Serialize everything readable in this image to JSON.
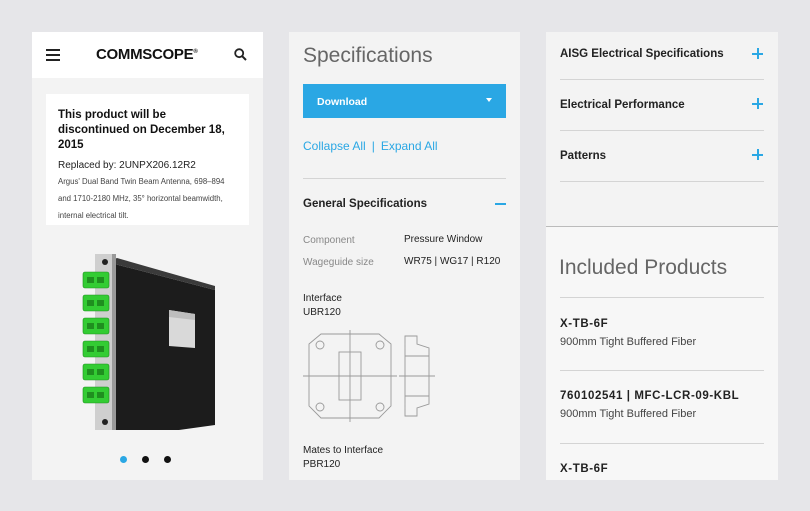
{
  "panel1": {
    "brand": "COMMSCOPE",
    "brand_mark": "®",
    "notice": {
      "title": "This product will be discontinued on December 18, 2015",
      "replaced_by": "Replaced by: 2UNPX206.12R2",
      "description": "Argus' Dual Band Twin Beam Antenna, 698–894 and 1710-2180 MHz, 35° horizontal beamwidth, internal electrical tilt."
    },
    "carousel": {
      "count": 3,
      "active_index": 0
    },
    "colors": {
      "accent": "#2aa7e4",
      "connector_green": "#33cc33"
    }
  },
  "panel2": {
    "heading": "Specifications",
    "download_label": "Download",
    "collapse_all": "Collapse All",
    "separator": "|",
    "expand_all": "Expand All",
    "section_title": "General Specifications",
    "specs": [
      {
        "label": "Component",
        "value": "Pressure Window"
      },
      {
        "label": "Wageguide size",
        "value": "WR75 | WG17 | R120"
      }
    ],
    "interface_label": "Interface",
    "interface_value": "UBR120",
    "mates_label": "Mates to Interface",
    "mates_value": "PBR120"
  },
  "panel3": {
    "accordion": [
      {
        "label": "AISG Electrical Specifications"
      },
      {
        "label": "Electrical Performance"
      },
      {
        "label": "Patterns"
      }
    ],
    "included_title": "Included Products",
    "products": [
      {
        "code": "X-TB-6F",
        "desc": "900mm Tight Buffered Fiber"
      },
      {
        "code": "760102541 | MFC-LCR-09-KBL",
        "desc": "900mm Tight Buffered Fiber"
      },
      {
        "code": "X-TB-6F",
        "desc": ""
      }
    ]
  }
}
